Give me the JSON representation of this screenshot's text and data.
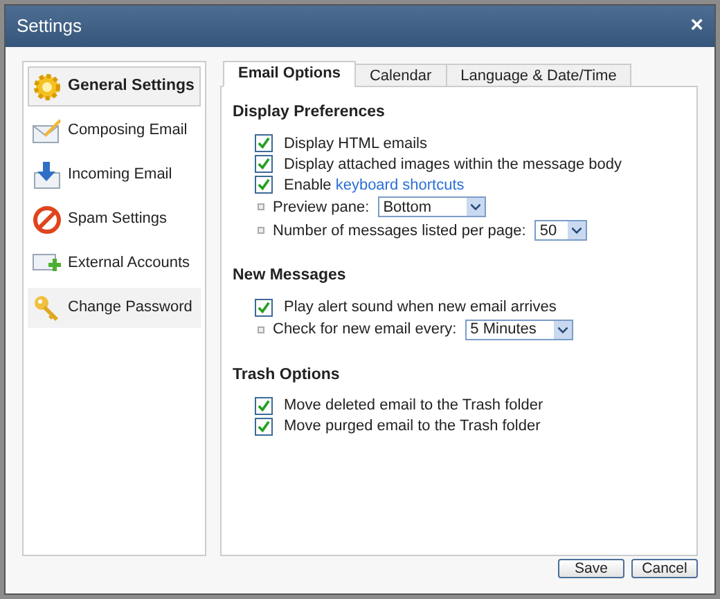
{
  "window": {
    "title": "Settings",
    "close": "×"
  },
  "sidebar": {
    "items": [
      {
        "label": "General Settings",
        "selected": true,
        "hovered": false
      },
      {
        "label": "Composing Email",
        "selected": false,
        "hovered": false
      },
      {
        "label": "Incoming Email",
        "selected": false,
        "hovered": false
      },
      {
        "label": "Spam Settings",
        "selected": false,
        "hovered": false
      },
      {
        "label": "External Accounts",
        "selected": false,
        "hovered": false
      },
      {
        "label": "Change Password",
        "selected": false,
        "hovered": true
      }
    ]
  },
  "tabs": [
    {
      "label": "Email Options",
      "selected": true
    },
    {
      "label": "Calendar",
      "selected": false
    },
    {
      "label": "Language & Date/Time",
      "selected": false
    }
  ],
  "sections": [
    {
      "title": "Display Preferences",
      "rows": [
        {
          "kind": "checkbox",
          "label": "Display HTML emails",
          "checked": true
        },
        {
          "kind": "checkbox",
          "label": "Display attached images within the message body",
          "checked": true
        },
        {
          "kind": "checkbox",
          "label": "Enable",
          "link": "keyboard shortcuts",
          "checked": true
        },
        {
          "kind": "select",
          "label": "Preview pane:",
          "value": "Bottom"
        },
        {
          "kind": "select",
          "label": "Number of messages listed per page:",
          "value": "50"
        }
      ]
    },
    {
      "title": "New Messages",
      "rows": [
        {
          "kind": "checkbox",
          "label": "Play alert sound when new email arrives",
          "checked": true
        },
        {
          "kind": "select",
          "label": "Check for new email every:",
          "value": "5 Minutes"
        }
      ]
    },
    {
      "title": "Trash Options",
      "rows": [
        {
          "kind": "checkbox",
          "label": "Move deleted email to the Trash folder",
          "checked": true
        },
        {
          "kind": "checkbox",
          "label": "Move purged email to the Trash folder",
          "checked": true
        }
      ]
    }
  ],
  "buttons": [
    "Save",
    "Cancel"
  ]
}
